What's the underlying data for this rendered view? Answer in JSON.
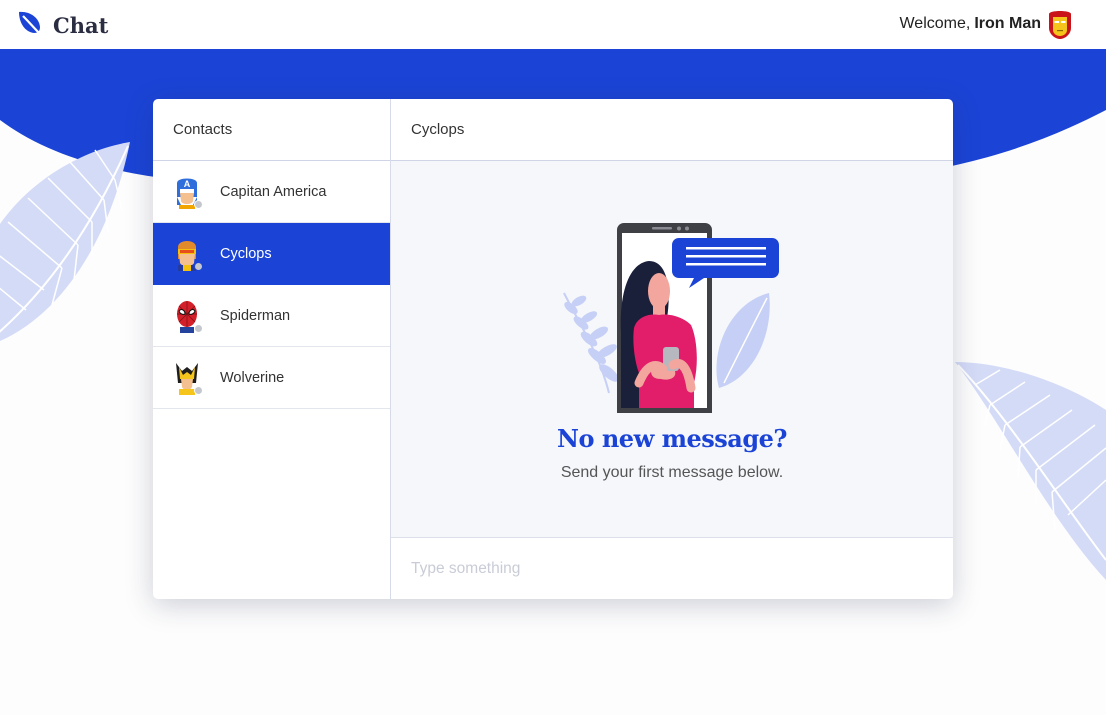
{
  "app": {
    "name": "Chat"
  },
  "header": {
    "welcome_prefix": "Welcome,",
    "username": "Iron Man",
    "avatar_icon": "iron-man-icon"
  },
  "contacts": {
    "title": "Contacts",
    "items": [
      {
        "name": "Capitan America",
        "icon": "captain-america-icon",
        "active": false
      },
      {
        "name": "Cyclops",
        "icon": "cyclops-icon",
        "active": true
      },
      {
        "name": "Spiderman",
        "icon": "spiderman-icon",
        "active": false
      },
      {
        "name": "Wolverine",
        "icon": "wolverine-icon",
        "active": false
      }
    ]
  },
  "chat": {
    "title": "Cyclops",
    "empty_title": "No new message?",
    "empty_subtitle": "Send your first message below.",
    "input_placeholder": "Type something"
  },
  "colors": {
    "accent": "#1b44d6",
    "leaf": "#d4dbf7",
    "panel_bg": "#f5f7fb"
  }
}
